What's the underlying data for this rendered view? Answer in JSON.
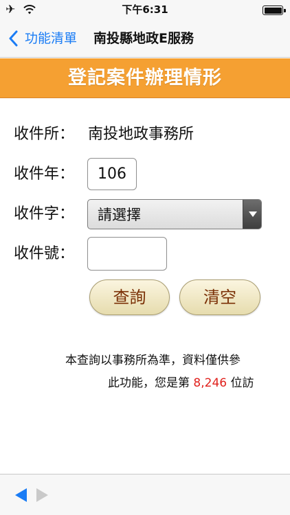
{
  "status_bar": {
    "time": "下午6:31",
    "icons": [
      "airplane-icon",
      "wifi-icon",
      "battery-icon"
    ]
  },
  "nav": {
    "back_label": "功能清單",
    "title": "南投縣地政E服務",
    "accent_color": "#1a7cf5"
  },
  "banner": {
    "title": "登記案件辦理情形",
    "color": "#f5a032"
  },
  "form": {
    "office_label": "收件所：",
    "office_value": "南投地政事務所",
    "year_label": "收件年：",
    "year_value": "106",
    "word_label": "收件字：",
    "word_selected": "請選擇",
    "number_label": "收件號：",
    "number_value": ""
  },
  "buttons": {
    "query_label": "查詢",
    "clear_label": "清空"
  },
  "notice": {
    "line1": "本查詢以事務所為準，資料僅供參",
    "line2_prefix": "此功能，您是第 ",
    "visitor_count": "8,246",
    "line2_suffix": " 位訪",
    "count_color": "#e0201c"
  },
  "toolbar": {
    "icons": [
      "back-arrow-icon",
      "forward-arrow-icon"
    ]
  }
}
